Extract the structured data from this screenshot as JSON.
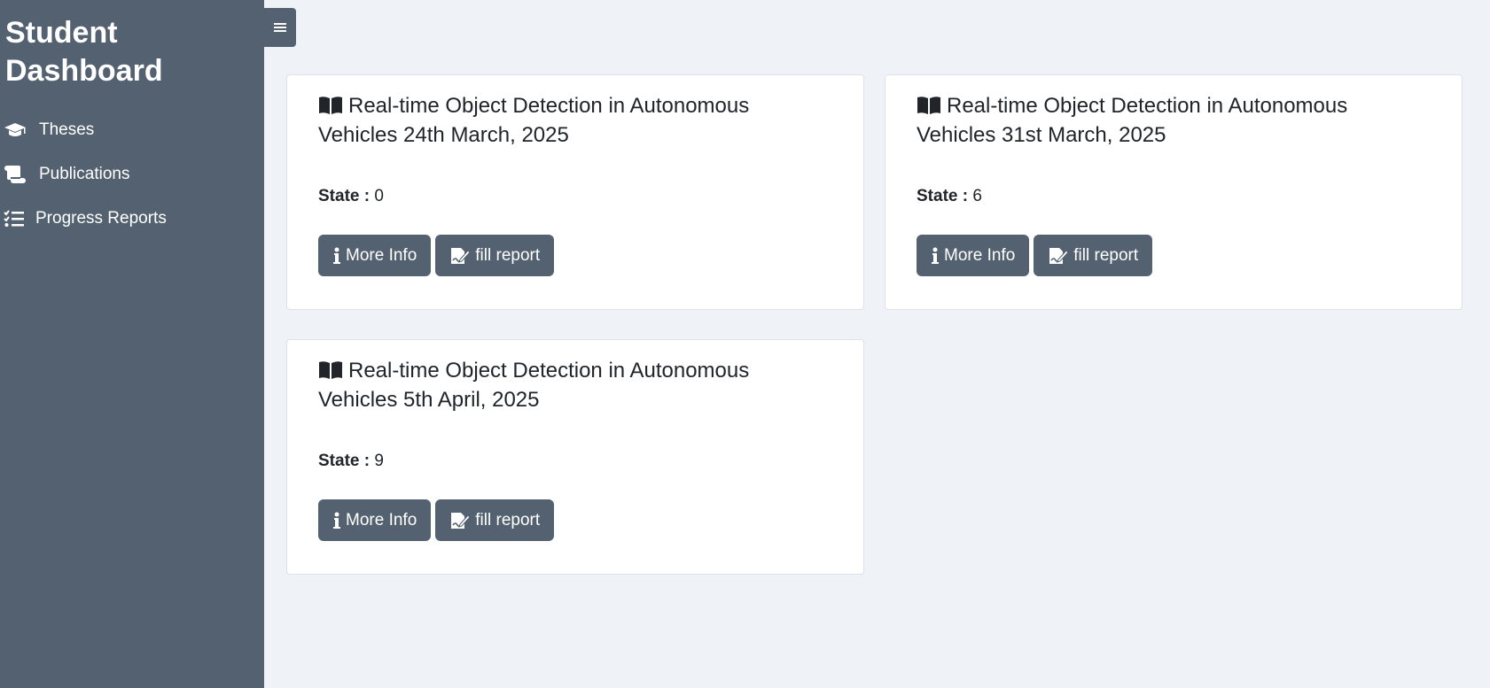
{
  "sidebar": {
    "title": "Student Dashboard",
    "items": [
      {
        "label": "Theses",
        "icon": "graduation-cap-icon"
      },
      {
        "label": "Publications",
        "icon": "scroll-icon"
      },
      {
        "label": "Progress Reports",
        "icon": "list-check-icon"
      }
    ]
  },
  "toggle": {
    "icon": "menu-icon"
  },
  "colors": {
    "sidebar": "#536170",
    "background": "#eff3f7",
    "button": "#536170"
  },
  "cards": [
    {
      "title": "Real-time Object Detection in Autonomous Vehicles 24th March, 2025",
      "state_label": "State :",
      "state_value": "0",
      "more_info": "More Info",
      "fill_report": "fill report"
    },
    {
      "title": "Real-time Object Detection in Autonomous Vehicles 31st March, 2025",
      "state_label": "State :",
      "state_value": "6",
      "more_info": "More Info",
      "fill_report": "fill report"
    },
    {
      "title": "Real-time Object Detection in Autonomous Vehicles 5th April, 2025",
      "state_label": "State :",
      "state_value": "9",
      "more_info": "More Info",
      "fill_report": "fill report"
    }
  ]
}
